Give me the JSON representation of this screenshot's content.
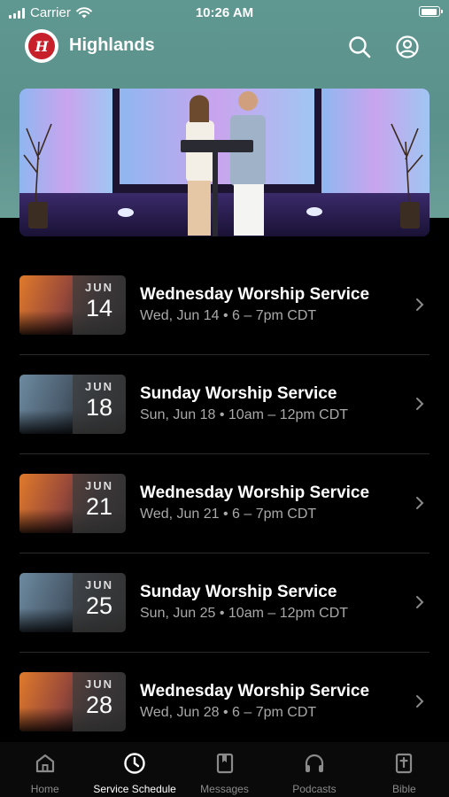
{
  "status_bar": {
    "carrier": "Carrier",
    "time": "10:26 AM"
  },
  "header": {
    "title": "Highlands",
    "logo_letter": "H"
  },
  "events": [
    {
      "month": "JUN",
      "day": "14",
      "title": "Wednesday Worship Service",
      "subtitle": "Wed, Jun 14 • 6 – 7pm CDT",
      "thumb": "warm"
    },
    {
      "month": "JUN",
      "day": "18",
      "title": "Sunday Worship Service",
      "subtitle": "Sun, Jun 18 • 10am – 12pm CDT",
      "thumb": "cool"
    },
    {
      "month": "JUN",
      "day": "21",
      "title": "Wednesday Worship Service",
      "subtitle": "Wed, Jun 21 • 6 – 7pm CDT",
      "thumb": "warm"
    },
    {
      "month": "JUN",
      "day": "25",
      "title": "Sunday Worship Service",
      "subtitle": "Sun, Jun 25 • 10am – 12pm CDT",
      "thumb": "cool"
    },
    {
      "month": "JUN",
      "day": "28",
      "title": "Wednesday Worship Service",
      "subtitle": "Wed, Jun 28 • 6 – 7pm CDT",
      "thumb": "warm"
    }
  ],
  "tabs": [
    {
      "label": "Home",
      "icon": "home-icon",
      "active": false
    },
    {
      "label": "Service Schedule",
      "icon": "clock-icon",
      "active": true
    },
    {
      "label": "Messages",
      "icon": "book-icon",
      "active": false
    },
    {
      "label": "Podcasts",
      "icon": "headphones-icon",
      "active": false
    },
    {
      "label": "Bible",
      "icon": "bible-icon",
      "active": false
    }
  ],
  "colors": {
    "header_teal": "#5f9891",
    "background": "#000000",
    "subtitle_gray": "#a9a9a9",
    "logo_red": "#c8202a"
  }
}
